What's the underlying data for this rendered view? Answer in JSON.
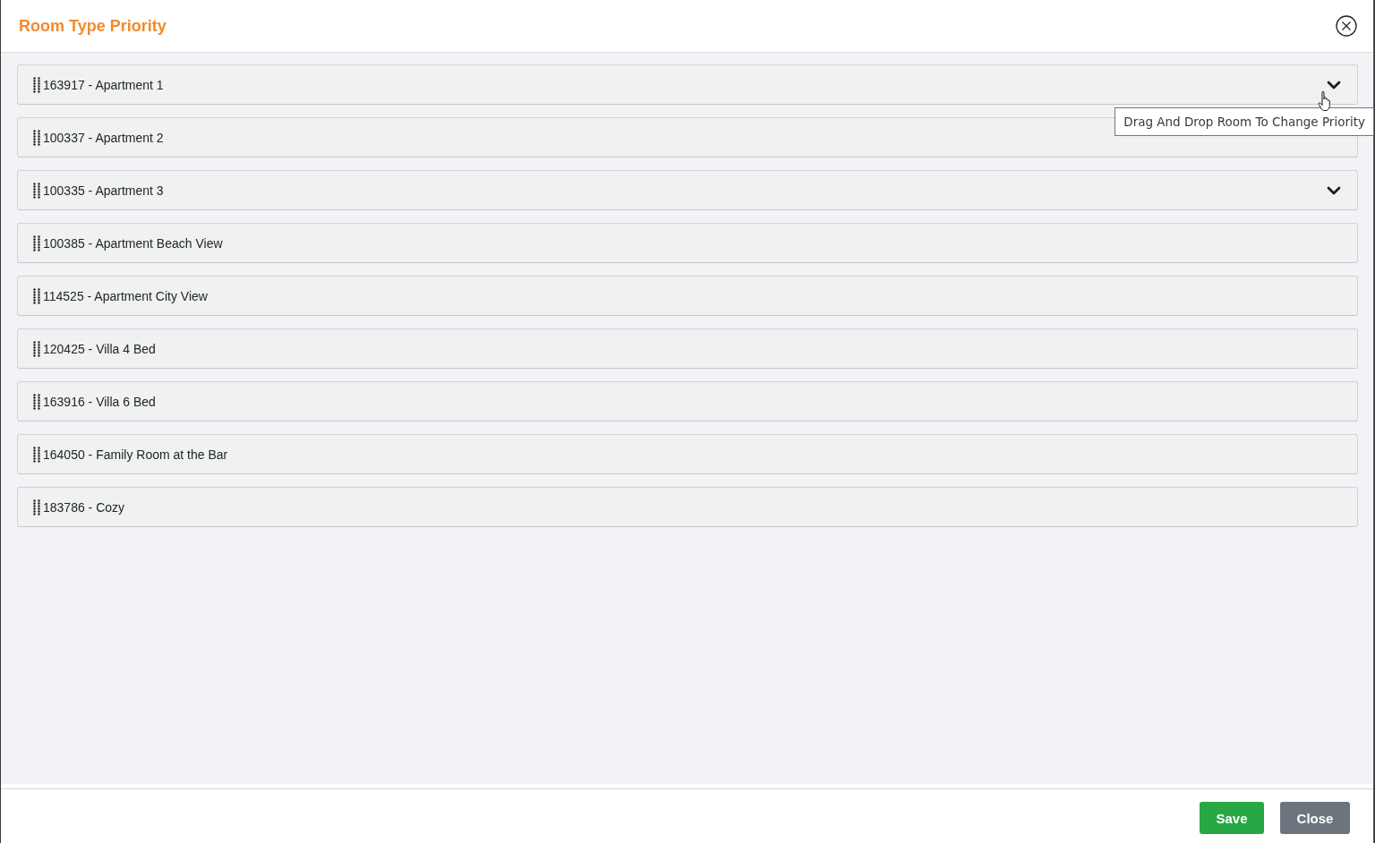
{
  "dialog": {
    "title": "Room Type Priority"
  },
  "room_types": [
    {
      "label": "163917 - Apartment 1",
      "expandable": true
    },
    {
      "label": "100337 - Apartment 2",
      "expandable": false
    },
    {
      "label": "100335 - Apartment 3",
      "expandable": true
    },
    {
      "label": "100385 - Apartment Beach View",
      "expandable": false
    },
    {
      "label": "114525 - Apartment City View",
      "expandable": false
    },
    {
      "label": "120425 - Villa 4 Bed",
      "expandable": false
    },
    {
      "label": "163916 - Villa 6 Bed",
      "expandable": false
    },
    {
      "label": "164050 - Family Room at the Bar",
      "expandable": false
    },
    {
      "label": "183786 - Cozy",
      "expandable": false
    }
  ],
  "tooltip": {
    "text": "Drag And Drop Room To Change Priority"
  },
  "buttons": [
    {
      "label": "Save",
      "kind": "primary"
    },
    {
      "label": "Close",
      "kind": "secondary"
    }
  ]
}
